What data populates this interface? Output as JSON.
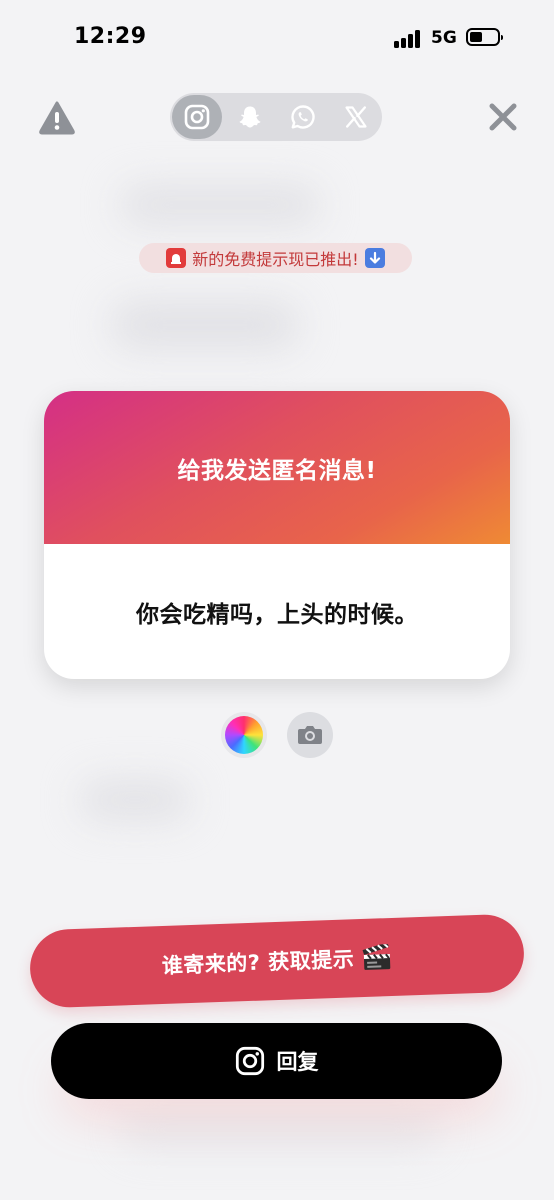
{
  "status_bar": {
    "time": "12:29",
    "network": "5G",
    "battery_level": 0.45
  },
  "header": {
    "share_options": [
      {
        "icon": "instagram-icon",
        "active": true
      },
      {
        "icon": "snapchat-icon",
        "active": false
      },
      {
        "icon": "whatsapp-icon",
        "active": false
      },
      {
        "icon": "x-twitter-icon",
        "active": false
      }
    ]
  },
  "promo": {
    "text": "新的免费提示现已推出!",
    "leading_emoji": "siren-emoji",
    "trailing_emoji": "down-arrow-emoji"
  },
  "card": {
    "title": "给我发送匿名消息!",
    "message": "你会吃精吗，上头的时候。"
  },
  "hint_button": {
    "label": "谁寄来的? 获取提示",
    "icon": "clapperboard-emoji",
    "color": "#d84557"
  },
  "reply_button": {
    "label": "回复",
    "icon": "instagram-icon"
  },
  "colors": {
    "accent_red": "#d84557",
    "promo_text": "#c3393a",
    "gradient_start": "#d42f86",
    "gradient_end": "#ef8a34"
  }
}
